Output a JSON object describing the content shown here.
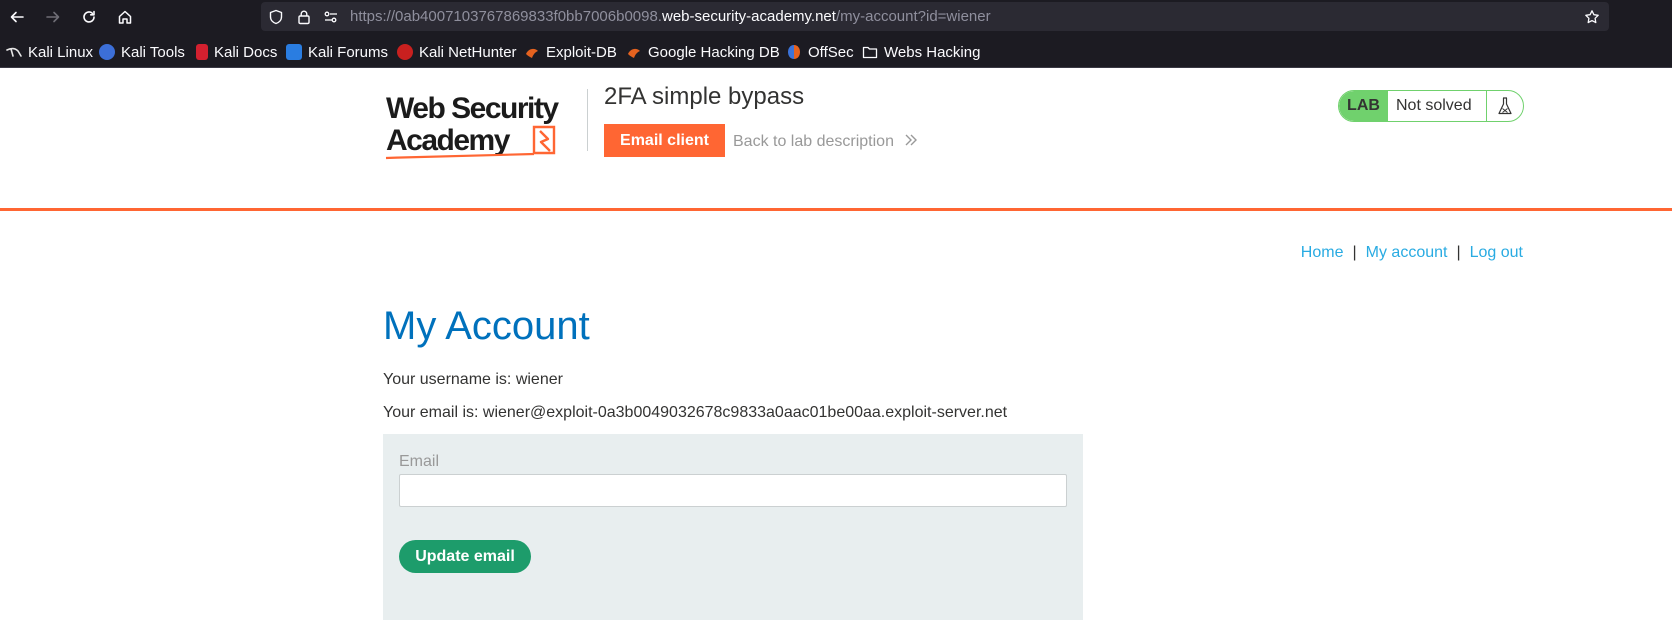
{
  "browser": {
    "url_scheme": "https://",
    "url_subdomain": "0ab4007103767869833f0bb7006b0098.",
    "url_host": "web-security-academy.net",
    "url_path": "/my-account?id=wiener"
  },
  "bookmarks": [
    {
      "label": "Kali Linux",
      "icon": "kali-linux-icon",
      "color": "#2f7fd4"
    },
    {
      "label": "Kali Tools",
      "icon": "kali-tools-icon",
      "color": "#3c6fd8"
    },
    {
      "label": "Kali Docs",
      "icon": "kali-docs-icon",
      "color": "#d3202f"
    },
    {
      "label": "Kali Forums",
      "icon": "kali-forums-icon",
      "color": "#2a7de1"
    },
    {
      "label": "Kali NetHunter",
      "icon": "kali-nethunter-icon",
      "color": "#c9201f"
    },
    {
      "label": "Exploit-DB",
      "icon": "exploit-db-icon",
      "color": "#e5621f"
    },
    {
      "label": "Google Hacking DB",
      "icon": "google-hacking-db-icon",
      "color": "#e5621f"
    },
    {
      "label": "OffSec",
      "icon": "offsec-icon",
      "color": "#3b73d9"
    },
    {
      "label": "Webs Hacking",
      "icon": "folder-icon",
      "color": "#fbfbfe"
    }
  ],
  "lab": {
    "title": "2FA simple bypass",
    "email_client_label": "Email client",
    "back_label": "Back to lab description",
    "back_chevron": "»",
    "status_tag": "LAB",
    "status_text": "Not solved"
  },
  "nav": {
    "home": "Home",
    "separator": "|",
    "my_account": "My account",
    "log_out": "Log out"
  },
  "account": {
    "heading": "My Account",
    "username_line": "Your username is: wiener",
    "email_line": "Your email is: wiener@exploit-0a3b0049032678c9833a0aac01be00aa.exploit-server.net",
    "email_label": "Email",
    "email_value": "",
    "update_label": "Update email"
  },
  "colors": {
    "accent_orange": "#ff6633",
    "heading_blue": "#0071bc",
    "link_blue": "#29abe2",
    "lab_green": "#70d16d",
    "button_green": "#1d9c6b",
    "form_bg": "#e8eeef"
  }
}
